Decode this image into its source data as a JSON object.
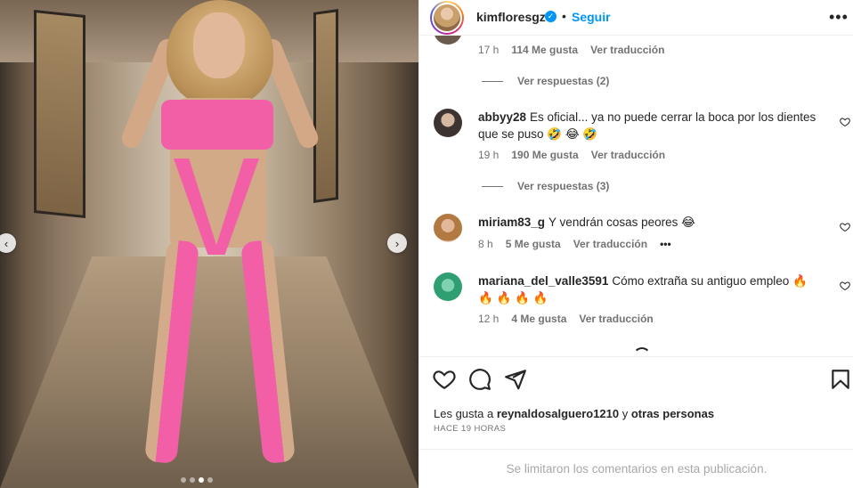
{
  "post": {
    "username": "kimfloresgz",
    "follow_label": "Seguir",
    "separator": "•",
    "verified_symbol": "✓",
    "more_symbol": "•••"
  },
  "carousel": {
    "prev_symbol": "‹",
    "next_symbol": "›",
    "slide_count": 4,
    "active_slide": 3
  },
  "comments": {
    "top_meta": {
      "time": "17 h",
      "likes": "114 Me gusta",
      "translate": "Ver traducción"
    },
    "top_replies": "Ver respuestas (2)",
    "items": [
      {
        "user": "abbyy28",
        "text": "Es oficial... ya no puede cerrar la boca por los dientes que se puso 🤣 😂 🤣",
        "time": "19 h",
        "likes": "190 Me gusta",
        "translate": "Ver traducción",
        "replies": "Ver respuestas (3)"
      },
      {
        "user": "miriam83_g",
        "text": "Y vendrán cosas peores 😂",
        "time": "8 h",
        "likes": "5 Me gusta",
        "translate": "Ver traducción",
        "options": "•••"
      },
      {
        "user": "mariana_del_valle3591",
        "text": "Cómo extraña su antiguo empleo 🔥 🔥 🔥 🔥 🔥",
        "time": "12 h",
        "likes": "4 Me gusta",
        "translate": "Ver traducción"
      }
    ]
  },
  "likes": {
    "prefix": "Les gusta a ",
    "user": "reynaldosalguero1210",
    "middle": " y ",
    "suffix": "otras personas"
  },
  "timestamp": "HACE 19 HORAS",
  "footer": "Se limitaron los comentarios en esta publicación.",
  "colors": {
    "accent": "#0095f6",
    "text": "#262626",
    "muted": "#737373",
    "pink": "#f25fa6"
  }
}
